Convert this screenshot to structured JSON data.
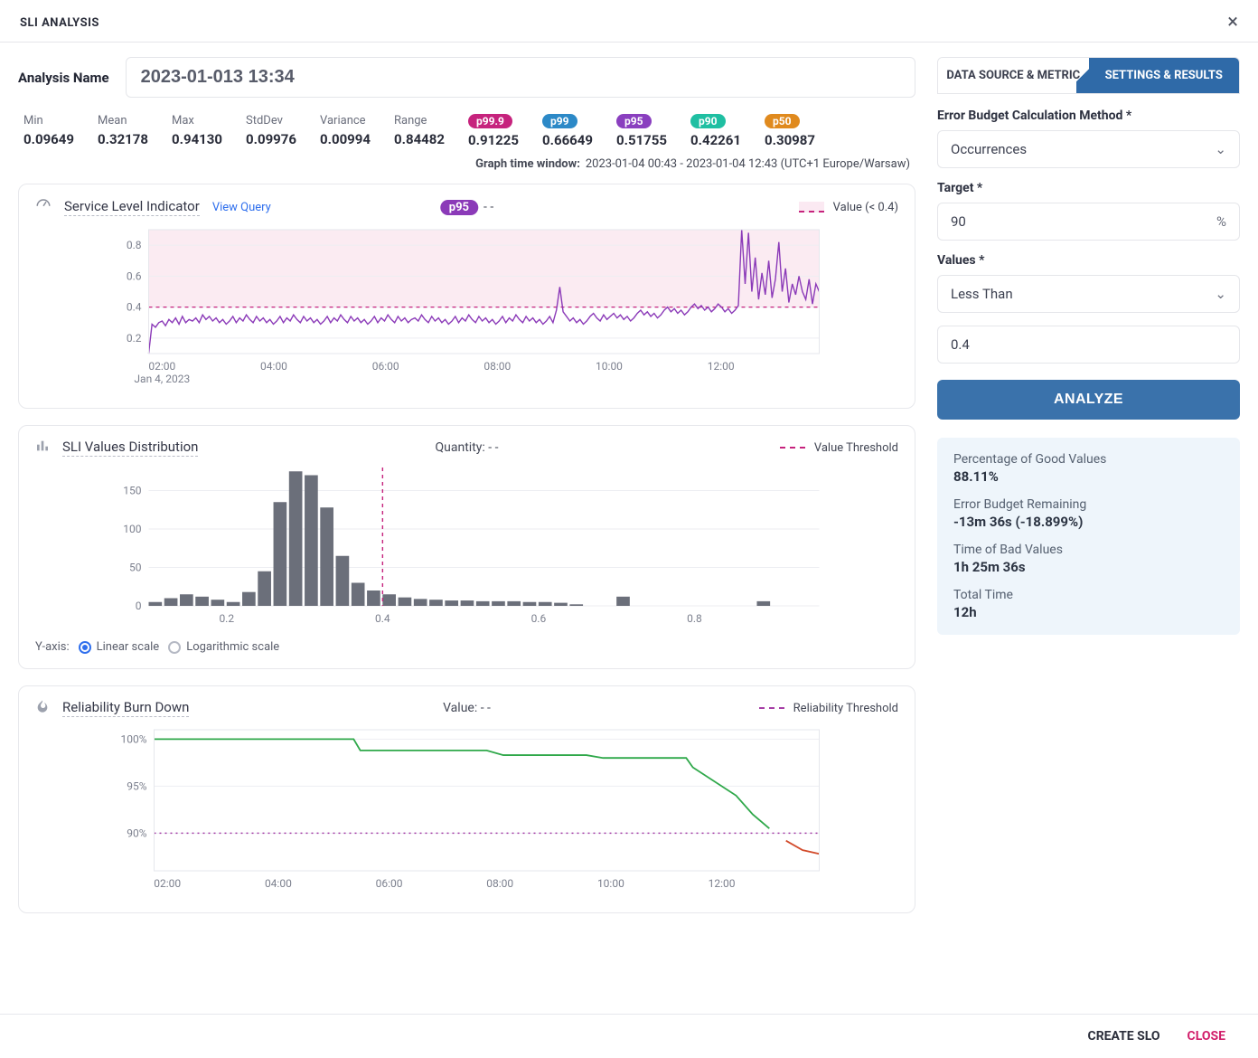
{
  "modal": {
    "title": "SLI ANALYSIS",
    "analysis_name_label": "Analysis Name",
    "analysis_name_value": "2023-01-013 13:34"
  },
  "stats": [
    {
      "label": "Min",
      "value": "0.09649"
    },
    {
      "label": "Mean",
      "value": "0.32178"
    },
    {
      "label": "Max",
      "value": "0.94130"
    },
    {
      "label": "StdDev",
      "value": "0.09976"
    },
    {
      "label": "Variance",
      "value": "0.00994"
    },
    {
      "label": "Range",
      "value": "0.84482"
    },
    {
      "pill": "p99.9",
      "pill_class": "pill-p999",
      "value": "0.91225"
    },
    {
      "pill": "p99",
      "pill_class": "pill-p99",
      "value": "0.66649"
    },
    {
      "pill": "p95",
      "pill_class": "pill-p95",
      "value": "0.51755"
    },
    {
      "pill": "p90",
      "pill_class": "pill-p90",
      "value": "0.42261"
    },
    {
      "pill": "p50",
      "pill_class": "pill-p50",
      "value": "0.30987"
    }
  ],
  "time_window": {
    "label": "Graph time window:",
    "value": "2023-01-04 00:43 - 2023-01-04 12:43 (UTC+1 Europe/Warsaw)"
  },
  "sli_chart": {
    "title": "Service Level Indicator",
    "view_query": "View Query",
    "badge": "p95",
    "badge_value": "- -",
    "legend_value": "Value (< 0.4)"
  },
  "dist_chart": {
    "title": "SLI Values Distribution",
    "center_label": "Quantity: - -",
    "legend": "Value Threshold",
    "yaxis_label": "Y-axis:",
    "linear": "Linear scale",
    "log": "Logarithmic scale"
  },
  "burn_chart": {
    "title": "Reliability Burn Down",
    "center_label": "Value: - -",
    "legend": "Reliability Threshold"
  },
  "tabs": {
    "data_source": "DATA SOURCE & METRIC",
    "settings": "SETTINGS & RESULTS"
  },
  "settings": {
    "budget_label": "Error Budget Calculation Method",
    "budget_value": "Occurrences",
    "target_label": "Target",
    "target_value": "90",
    "target_suffix": "%",
    "values_label": "Values",
    "values_op": "Less Than",
    "values_num": "0.4",
    "analyze": "ANALYZE"
  },
  "results": {
    "good_label": "Percentage of Good Values",
    "good_value": "88.11%",
    "budget_label": "Error Budget Remaining",
    "budget_value": "-13m 36s (-18.899%)",
    "bad_label": "Time of Bad Values",
    "bad_value": "1h 25m 36s",
    "total_label": "Total Time",
    "total_value": "12h"
  },
  "footer": {
    "create": "CREATE SLO",
    "close": "CLOSE"
  },
  "chart_data": [
    {
      "id": "sli",
      "type": "line",
      "title": "Service Level Indicator",
      "xlabel": "",
      "ylabel": "",
      "ylim": [
        0.1,
        0.9
      ],
      "y_ticks": [
        0.2,
        0.4,
        0.6,
        0.8
      ],
      "x_ticks": [
        "02:00",
        "04:00",
        "06:00",
        "08:00",
        "10:00",
        "12:00"
      ],
      "x_tick_sub": "Jan 4, 2023",
      "threshold": 0.4,
      "band_above_threshold": true,
      "series": [
        {
          "name": "p95",
          "color": "#8b3ab8",
          "values": [
            0.1,
            0.29,
            0.27,
            0.3,
            0.31,
            0.28,
            0.32,
            0.3,
            0.33,
            0.29,
            0.34,
            0.3,
            0.32,
            0.31,
            0.33,
            0.3,
            0.35,
            0.32,
            0.34,
            0.31,
            0.33,
            0.3,
            0.32,
            0.29,
            0.31,
            0.34,
            0.3,
            0.33,
            0.31,
            0.35,
            0.32,
            0.3,
            0.34,
            0.31,
            0.33,
            0.3,
            0.32,
            0.29,
            0.31,
            0.34,
            0.3,
            0.33,
            0.31,
            0.35,
            0.32,
            0.3,
            0.34,
            0.31,
            0.33,
            0.3,
            0.32,
            0.29,
            0.31,
            0.34,
            0.3,
            0.33,
            0.31,
            0.35,
            0.32,
            0.3,
            0.34,
            0.31,
            0.33,
            0.3,
            0.32,
            0.29,
            0.31,
            0.34,
            0.3,
            0.33,
            0.31,
            0.35,
            0.32,
            0.3,
            0.34,
            0.31,
            0.33,
            0.3,
            0.32,
            0.33,
            0.31,
            0.35,
            0.32,
            0.3,
            0.34,
            0.31,
            0.33,
            0.3,
            0.32,
            0.29,
            0.31,
            0.34,
            0.3,
            0.33,
            0.31,
            0.35,
            0.32,
            0.3,
            0.34,
            0.31,
            0.33,
            0.3,
            0.32,
            0.29,
            0.31,
            0.34,
            0.3,
            0.33,
            0.31,
            0.35,
            0.32,
            0.3,
            0.34,
            0.31,
            0.33,
            0.3,
            0.32,
            0.29,
            0.31,
            0.34,
            0.3,
            0.38,
            0.53,
            0.37,
            0.34,
            0.31,
            0.33,
            0.3,
            0.32,
            0.29,
            0.31,
            0.34,
            0.36,
            0.33,
            0.31,
            0.35,
            0.32,
            0.34,
            0.36,
            0.33,
            0.35,
            0.32,
            0.34,
            0.31,
            0.33,
            0.36,
            0.38,
            0.35,
            0.37,
            0.34,
            0.36,
            0.33,
            0.35,
            0.38,
            0.4,
            0.37,
            0.39,
            0.36,
            0.38,
            0.35,
            0.37,
            0.4,
            0.42,
            0.39,
            0.41,
            0.38,
            0.4,
            0.37,
            0.39,
            0.42,
            0.4,
            0.37,
            0.39,
            0.36,
            0.38,
            0.41,
            0.9,
            0.55,
            0.88,
            0.5,
            0.72,
            0.45,
            0.62,
            0.48,
            0.7,
            0.46,
            0.58,
            0.82,
            0.5,
            0.65,
            0.43,
            0.55,
            0.48,
            0.6,
            0.5,
            0.45,
            0.58,
            0.42,
            0.55,
            0.5
          ]
        }
      ]
    },
    {
      "id": "dist",
      "type": "bar",
      "title": "SLI Values Distribution",
      "ylim": [
        0,
        180
      ],
      "y_ticks": [
        0,
        50,
        100,
        150
      ],
      "x_ticks": [
        "0.2",
        "0.4",
        "0.6",
        "0.8"
      ],
      "threshold_x": 0.4,
      "bin_start": 0.1,
      "bin_width": 0.02,
      "values": [
        5,
        10,
        15,
        12,
        8,
        5,
        18,
        45,
        135,
        175,
        170,
        128,
        65,
        30,
        20,
        15,
        11,
        9,
        8,
        7,
        7,
        6,
        6,
        6,
        5,
        5,
        4,
        2,
        0,
        0,
        12,
        0,
        0,
        0,
        0,
        0,
        0,
        0,
        0,
        6,
        0,
        0,
        0
      ]
    },
    {
      "id": "burn",
      "type": "line",
      "title": "Reliability Burn Down",
      "ylim": [
        86,
        101
      ],
      "y_ticks": [
        90,
        95,
        100
      ],
      "y_tick_labels": [
        "90%",
        "95%",
        "100%"
      ],
      "x_ticks": [
        "02:00",
        "04:00",
        "06:00",
        "08:00",
        "10:00",
        "12:00"
      ],
      "threshold_y": 90,
      "series": [
        {
          "name": "reliability",
          "values": [
            [
              0,
              100
            ],
            [
              60,
              100
            ],
            [
              62,
              98.8
            ],
            [
              100,
              98.8
            ],
            [
              105,
              98.3
            ],
            [
              130,
              98.3
            ],
            [
              135,
              98.0
            ],
            [
              160,
              98.0
            ],
            [
              162,
              97.0
            ],
            [
              175,
              94.0
            ],
            [
              180,
              92.0
            ],
            [
              185,
              90.5
            ],
            [
              190,
              89.2
            ],
            [
              195,
              88.2
            ],
            [
              200,
              87.8
            ]
          ]
        }
      ]
    }
  ]
}
